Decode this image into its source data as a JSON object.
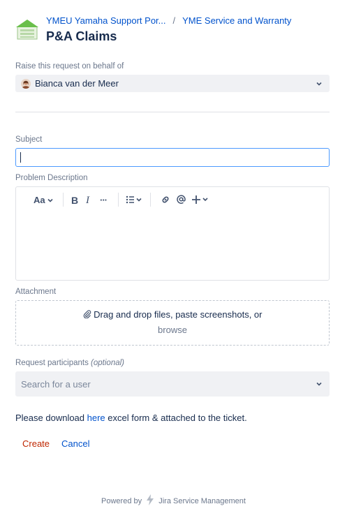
{
  "header": {
    "breadcrumb_portal": "YMEU Yamaha Support Por...",
    "breadcrumb_sep": "/",
    "breadcrumb_service": "YME Service and Warranty",
    "title": "P&A Claims"
  },
  "behalf": {
    "label": "Raise this request on behalf of",
    "value": "Bianca van der Meer"
  },
  "subject": {
    "label": "Subject",
    "value": ""
  },
  "description": {
    "label": "Problem Description",
    "toolbar": {
      "text_style": "Aa",
      "bold": "B",
      "italic": "I",
      "more": "···"
    }
  },
  "attachment": {
    "label": "Attachment",
    "line1": "Drag and drop files, paste screenshots, or",
    "browse": "browse"
  },
  "participants": {
    "label": "Request participants",
    "optional": "(optional)",
    "placeholder": "Search for a user"
  },
  "note": {
    "before": "Please download ",
    "link": "here",
    "after": " excel form & attached to the ticket."
  },
  "actions": {
    "create": "Create",
    "cancel": "Cancel"
  },
  "footer": {
    "powered_by": "Powered by",
    "product": "Jira Service Management"
  },
  "colors": {
    "link": "#0052cc",
    "create": "#bf2600",
    "focus": "#4c9aff",
    "field_bg": "#f0f1f4"
  }
}
